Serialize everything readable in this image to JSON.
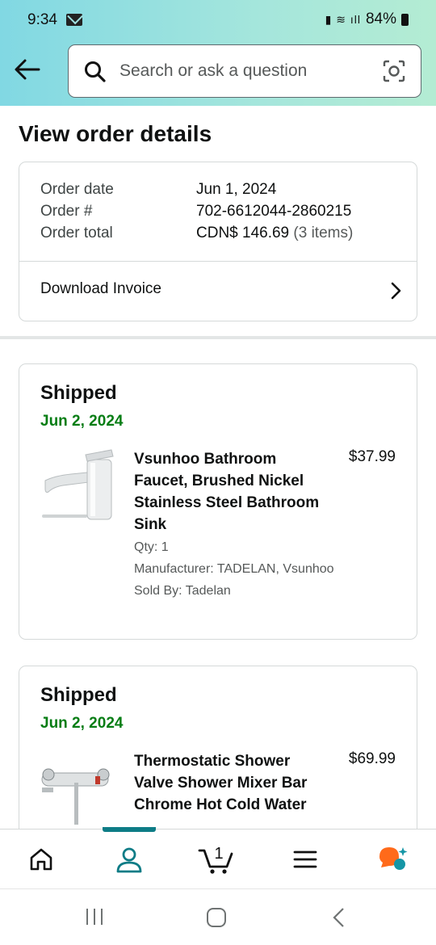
{
  "status_bar": {
    "time": "9:34",
    "battery": "84%"
  },
  "search": {
    "placeholder": "Search or ask a question"
  },
  "page": {
    "title": "View order details"
  },
  "order": {
    "date_label": "Order date",
    "date_value": "Jun 1, 2024",
    "number_label": "Order #",
    "number_value": "702-6612044-2860215",
    "total_label": "Order total",
    "total_value": "CDN$ 146.69",
    "items_count": "(3 items)",
    "invoice_label": "Download Invoice"
  },
  "shipments": [
    {
      "status": "Shipped",
      "date": "Jun 2, 2024",
      "product": "Vsunhoo Bathroom Faucet, Brushed Nickel Stainless Steel Bathroom Sink",
      "price": "$37.99",
      "qty": "Qty: 1",
      "manufacturer": "Manufacturer: TADELAN, Vsunhoo",
      "sold_by": "Sold By: Tadelan"
    },
    {
      "status": "Shipped",
      "date": "Jun 2, 2024",
      "product": "Thermostatic Shower Valve Shower Mixer Bar Chrome Hot Cold Water",
      "price": "$69.99"
    }
  ],
  "bottom_nav": {
    "cart_count": "1"
  },
  "icons": [
    "back-arrow-icon",
    "search-icon",
    "camera-lens-icon",
    "chevron-right-icon",
    "home-icon",
    "account-icon",
    "cart-icon",
    "menu-icon",
    "rufus-icon"
  ],
  "colors": {
    "accent": "#0e7c86",
    "ship_date": "#067d14",
    "header_start": "#81d8e3",
    "header_end": "#b4ecd3"
  }
}
